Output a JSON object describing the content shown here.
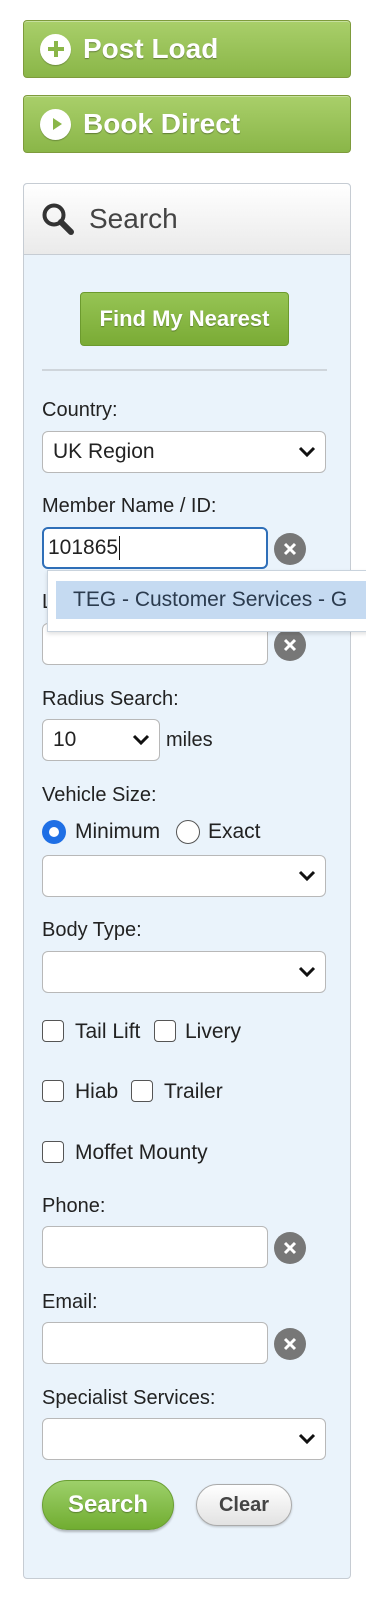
{
  "actions": {
    "post_load": "Post Load",
    "book_direct": "Book Direct"
  },
  "search_panel": {
    "title": "Search",
    "find_nearest": "Find My Nearest",
    "country": {
      "label": "Country:",
      "value": "UK Region"
    },
    "member": {
      "label": "Member Name / ID:",
      "value": "101865",
      "suggestion": "TEG - Customer Services - G"
    },
    "location": {
      "label_partial": "L",
      "value": ""
    },
    "radius": {
      "label": "Radius Search:",
      "value": "10",
      "unit": "miles"
    },
    "vehicle_size": {
      "label": "Vehicle Size:",
      "option_min": "Minimum",
      "option_exact": "Exact",
      "selected": "Minimum",
      "value": ""
    },
    "body_type": {
      "label": "Body Type:",
      "value": ""
    },
    "features": {
      "tail_lift": "Tail Lift",
      "livery": "Livery",
      "hiab": "Hiab",
      "trailer": "Trailer",
      "moffet": "Moffet Mounty"
    },
    "phone": {
      "label": "Phone:",
      "value": ""
    },
    "email": {
      "label": "Email:",
      "value": ""
    },
    "specialist": {
      "label": "Specialist Services:",
      "value": ""
    },
    "search_button": "Search",
    "clear_button": "Clear"
  },
  "colors": {
    "action_green": "#9dc45f",
    "find_green": "#86b640",
    "panel_bg": "#eaf3fb",
    "focus_blue": "#2f6fb8",
    "suggestion_bg": "#c5daf1"
  },
  "icons": {
    "post_load": "plus-circle-icon",
    "book_direct": "play-circle-icon",
    "search": "magnifier-icon",
    "clear": "x-circle-icon",
    "dropdown": "chevron-down-icon"
  }
}
